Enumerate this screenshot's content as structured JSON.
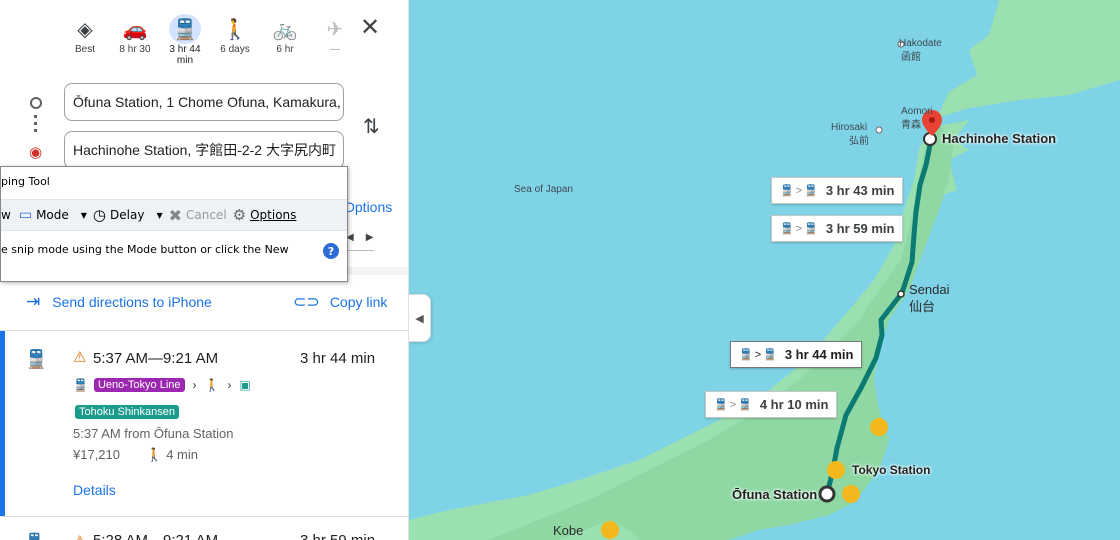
{
  "modes": [
    {
      "name": "best",
      "icon": "◈",
      "label": "Best"
    },
    {
      "name": "drive",
      "icon": "🚗",
      "label": "8 hr 30"
    },
    {
      "name": "transit",
      "icon": "🚆",
      "label": "3 hr 44\nmin"
    },
    {
      "name": "walk",
      "icon": "🚶",
      "label": "6 days"
    },
    {
      "name": "bike",
      "icon": "🚲",
      "label": "6 hr"
    },
    {
      "name": "flight",
      "icon": "✈",
      "label": "—"
    }
  ],
  "close_glyph": "✕",
  "origin": "Ōfuna Station, 1 Chome Ofuna, Kamakura,",
  "destination": "Hachinohe Station, 字館田-2-2 大字尻内町",
  "options_label": "Options",
  "send_label": "Send directions to iPhone",
  "copy_label": "Copy link",
  "trip": {
    "times": "5:37 AM—9:21 AM",
    "duration": "3 hr 44 min",
    "line1": "Ueno-Tokyo Line",
    "line2": "Tohoku Shinkansen",
    "from": "5:37 AM from Ōfuna Station",
    "fare": "¥17,210",
    "walk": "4 min",
    "details": "Details"
  },
  "next_trip": {
    "times": "5:28 AM—9:21 AM",
    "duration": "3 hr 59 min"
  },
  "snip": {
    "title": "ping Tool",
    "new": "w",
    "mode": "Mode",
    "delay": "Delay",
    "cancel": "Cancel",
    "options": "Options",
    "message": "e snip mode using the Mode button or click the New",
    "help": "?"
  },
  "map": {
    "sea": "Sea of Japan",
    "hakodate": "Hakodate",
    "hakodate_jp": "函館",
    "aomori": "Aomori",
    "aomori_jp": "青森",
    "hirosaki": "Hirosaki",
    "hirosaki_jp": "弘前",
    "sendai": "Sendai",
    "sendai_jp": "仙台",
    "kobe": "Kobe",
    "hachinohe": "Hachinohe Station",
    "tokyo": "Tokyo Station",
    "ofuna": "Ōfuna Station",
    "routes": [
      "3 hr 43 min",
      "3 hr 59 min",
      "3 hr 44 min",
      "4 hr 10 min"
    ]
  },
  "colors": {
    "route": "#0b7a72",
    "accent": "#1a73e8",
    "land": "#9be0b0",
    "water": "#7fd3e6"
  }
}
